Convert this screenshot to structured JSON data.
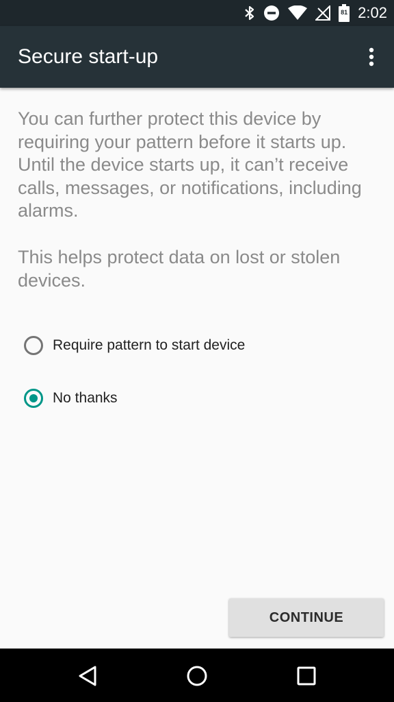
{
  "status_bar": {
    "time": "2:02",
    "battery_level": "81",
    "icons": [
      "bluetooth-icon",
      "do-not-disturb-icon",
      "wifi-icon",
      "no-signal-icon",
      "battery-icon"
    ]
  },
  "app_bar": {
    "title": "Secure start-up",
    "menu_icon": "more-vert-icon"
  },
  "content": {
    "description_1": "You can further protect this device by requiring your pattern before it starts up. Until the device starts up, it can’t receive calls, messages, or notifications, including alarms.",
    "description_2": "This helps protect data on lost or stolen devices.",
    "options": [
      {
        "label": "Require pattern to start device",
        "selected": false
      },
      {
        "label": "No thanks",
        "selected": true
      }
    ],
    "continue_label": "CONTINUE"
  },
  "colors": {
    "accent": "#009688",
    "app_bar": "#263238",
    "status_bar": "#1e272c"
  },
  "nav_bar": {
    "icons": [
      "back-icon",
      "home-icon",
      "recents-icon"
    ]
  }
}
